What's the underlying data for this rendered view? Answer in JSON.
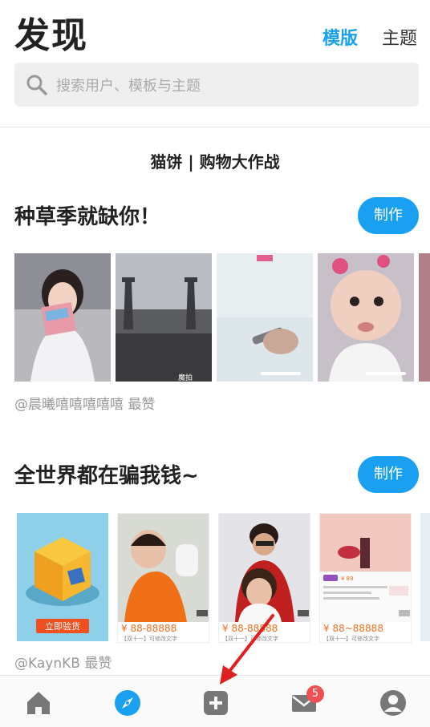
{
  "header": {
    "title": "发现",
    "tabs": [
      {
        "label": "模版",
        "active": true
      },
      {
        "label": "主题",
        "active": false
      }
    ]
  },
  "search": {
    "placeholder": "搜索用户、模板与主题"
  },
  "banner": "猫饼 | 购物大作战",
  "sections": [
    {
      "title": "种草季就缺你！",
      "make_label": "制作",
      "caption": "@晨曦嘻嘻嘻嘻嘻 最赞",
      "thumb_texts": [
        "",
        "魔拍",
        "",
        "",
        ""
      ]
    },
    {
      "title": "全世界都在骗我钱~",
      "make_label": "制作",
      "caption": "@KaynKB 最赞",
      "products": [
        {
          "badge_text": "立即验货",
          "price": "",
          "desc": ""
        },
        {
          "price": "¥ 88-88888",
          "desc": "【双十一】可修改文字"
        },
        {
          "price": "¥ 88-88888",
          "desc": "【双十一】可修改文字"
        },
        {
          "price": "¥ 88~88888",
          "desc": "【双十一】可修改文字",
          "mini_price": "¥ 89"
        }
      ]
    }
  ],
  "tabbar": {
    "items": [
      "home-icon",
      "discover-icon",
      "create-icon",
      "messages-icon",
      "profile-icon"
    ],
    "active": "discover-icon",
    "message_badge": "5"
  },
  "colors": {
    "accent": "#1aa0f0",
    "badge": "#f05050",
    "price": "#f07020",
    "arrow": "#e02020"
  }
}
